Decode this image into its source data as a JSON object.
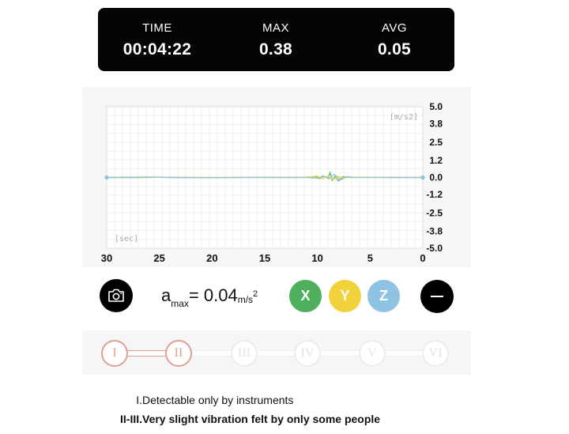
{
  "stats": [
    {
      "label": "TIME",
      "value": "00:04:22"
    },
    {
      "label": "MAX",
      "value": "0.38"
    },
    {
      "label": "AVG",
      "value": "0.05"
    }
  ],
  "chart_data": {
    "type": "line",
    "ylabel": "[m/s2]",
    "xlabel": "[sec]",
    "y_ticks": [
      "5.0",
      "3.8",
      "2.5",
      "1.2",
      "0.0",
      "-1.2",
      "-2.5",
      "-3.8",
      "-5.0"
    ],
    "x_ticks": [
      "30",
      "25",
      "20",
      "15",
      "10",
      "5",
      "0"
    ],
    "ylim": [
      -5.0,
      5.0
    ],
    "xlim": [
      30,
      0
    ],
    "grid": true,
    "series": [
      {
        "axis": "X",
        "color": "#5cb96a",
        "x": [
          30,
          26,
          24,
          20,
          16,
          12,
          10,
          9.8,
          9.5,
          9.0,
          8.8,
          8.6,
          8.3,
          8.0,
          7.6,
          7.0,
          6,
          3,
          0
        ],
        "y": [
          0.0,
          0.02,
          0.0,
          -0.01,
          0.01,
          0.0,
          0.05,
          -0.08,
          0.12,
          -0.06,
          0.35,
          -0.2,
          0.1,
          -0.25,
          0.05,
          0.0,
          0.01,
          0.0,
          0.0
        ]
      },
      {
        "axis": "Y",
        "color": "#f2d23c",
        "x": [
          30,
          27,
          25,
          22,
          18,
          14,
          11,
          10,
          9.5,
          9.0,
          8.5,
          8.0,
          7.5,
          7.0,
          5,
          2,
          0
        ],
        "y": [
          0.0,
          -0.02,
          0.02,
          0.0,
          0.01,
          -0.01,
          0.02,
          0.1,
          -0.1,
          0.12,
          -0.15,
          0.08,
          -0.04,
          0.02,
          0.0,
          0.01,
          0.0
        ]
      },
      {
        "axis": "Z",
        "color": "#8fc3e3",
        "x": [
          30,
          28,
          26,
          23,
          19,
          15,
          11,
          10,
          9.3,
          8.9,
          8.4,
          7.8,
          7.2,
          6.5,
          4,
          1,
          0
        ],
        "y": [
          0.01,
          -0.01,
          0.03,
          0.0,
          -0.01,
          0.01,
          0.0,
          -0.06,
          0.08,
          -0.12,
          0.22,
          -0.18,
          0.06,
          0.0,
          0.01,
          0.0,
          0.01
        ]
      }
    ]
  },
  "controls": {
    "amax_letter": "a",
    "amax_sub": "max",
    "amax_value": "= 0.04",
    "amax_unit": "m/s",
    "amax_unit_exp": "2",
    "axis_buttons": [
      {
        "label": "X",
        "color": "#4eb05d"
      },
      {
        "label": "Y",
        "color": "#f2d23c"
      },
      {
        "label": "Z",
        "color": "#8fc3e3"
      }
    ]
  },
  "scale": {
    "nodes": [
      "I",
      "II",
      "III",
      "IV",
      "V",
      "VI"
    ],
    "active_count": 2,
    "accent": "#df9f93"
  },
  "descriptions": [
    {
      "num": "I.",
      "text": "Detectable only by instruments",
      "bold": false
    },
    {
      "num": "II-III.",
      "text": "Very slight vibration felt by only some people",
      "bold": true
    }
  ]
}
